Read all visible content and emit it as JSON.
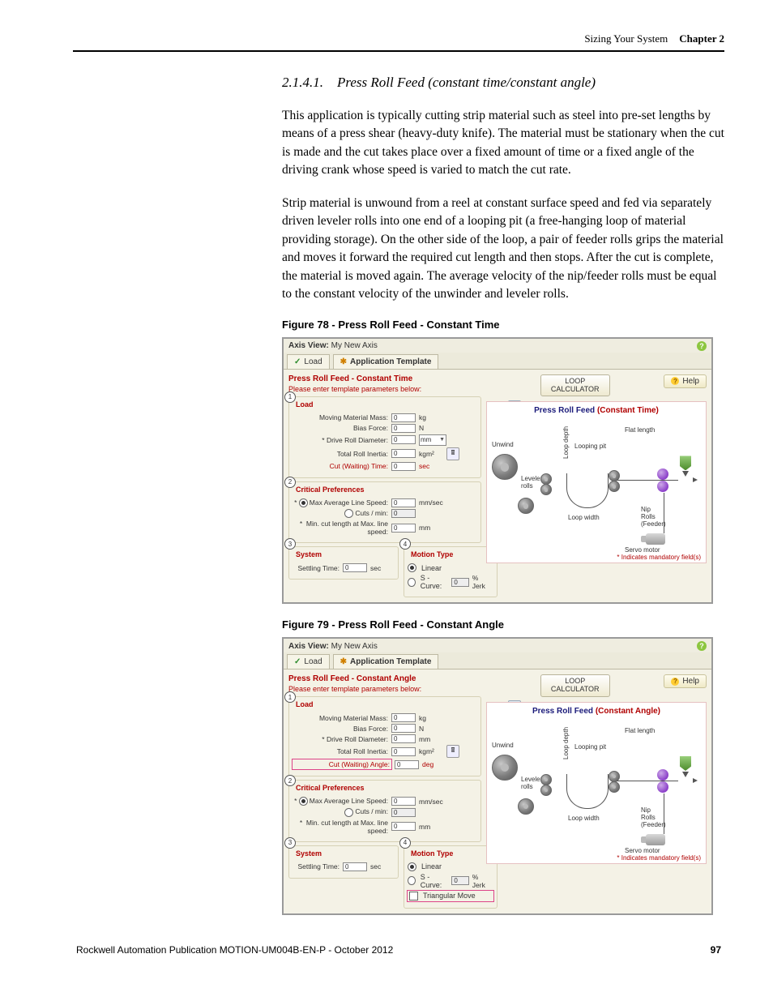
{
  "header": {
    "section": "Sizing Your System",
    "chapter": "Chapter 2"
  },
  "section": {
    "number": "2.1.4.1.",
    "title": "Press Roll Feed (constant time/constant angle)"
  },
  "paragraphs": [
    "This application is typically cutting strip material such as steel into pre-set lengths by means of a press shear (heavy-duty knife). The material must be stationary when the cut is made and the cut takes place over a fixed amount of time or a fixed angle of the driving crank whose speed is varied to match the cut rate.",
    "Strip material is unwound from a reel at constant surface speed and fed via separately driven leveler rolls into one end of a looping pit (a free-hanging loop of material providing storage). On the other side of the loop, a pair of feeder rolls grips the material and moves it forward the required cut length and then stops. After the cut is complete, the material is moved again. The average velocity of the nip/feeder rolls must be equal to the constant velocity of the unwinder and leveler rolls."
  ],
  "figures": {
    "f78": {
      "caption": "Figure 78 - Press Roll Feed - Constant Time"
    },
    "f79": {
      "caption": "Figure 79 - Press Roll Feed - Constant Angle"
    }
  },
  "shot": {
    "axis_label": "Axis View:",
    "axis_name": "My New Axis",
    "tabs": {
      "load": "Load",
      "app": "Application Template"
    },
    "help": "Help",
    "subtitle": "Please enter template parameters below:",
    "loop_calc": "LOOP\nCALCULATOR",
    "inertia_calc": "INERTIA\nCALCULATOR",
    "sections": {
      "load": "Load",
      "critical": "Critical Preferences",
      "system": "System",
      "motion": "Motion Type"
    },
    "labels": {
      "mass": "Moving Material Mass:",
      "bias": "Bias Force:",
      "drive": "* Drive Roll Diameter:",
      "inertia": "Total Roll Inertia:",
      "cut_time": "Cut (Waiting) Time:",
      "cut_angle": "Cut (Waiting) Angle:",
      "max_line": "Max Average Line Speed:",
      "cuts": "Cuts / min:",
      "min_cut": "Min. cut length at Max. line speed:",
      "settling": "Settling Time:",
      "linear": "Linear",
      "scurve": "S - Curve:",
      "tri": "Triangular Move",
      "pjerk": "% Jerk"
    },
    "units": {
      "kg": "kg",
      "N": "N",
      "mm": "mm",
      "kgm2": "kgm²",
      "sec": "sec",
      "deg": "deg",
      "mmsec": "mm/sec"
    },
    "val_zero": "0",
    "diagram": {
      "title_time": "Press Roll Feed (Constant Time)",
      "title_angle": "Press Roll Feed (Constant Angle)",
      "unwind": "Unwind",
      "leveler": "Leveler\nrolls",
      "looping": "Looping pit",
      "loop_depth": "Loop depth",
      "loop_width": "Loop width",
      "flat": "Flat length",
      "nip": "Nip\nRolls\n(Feeder)",
      "servo": "Servo motor",
      "mand": "* Indicates mandatory field(s)"
    },
    "title78": "Press Roll Feed - Constant Time",
    "title79": "Press Roll Feed - Constant Angle"
  },
  "footer": {
    "pub": "Rockwell Automation Publication MOTION-UM004B-EN-P - October 2012",
    "page": "97"
  }
}
